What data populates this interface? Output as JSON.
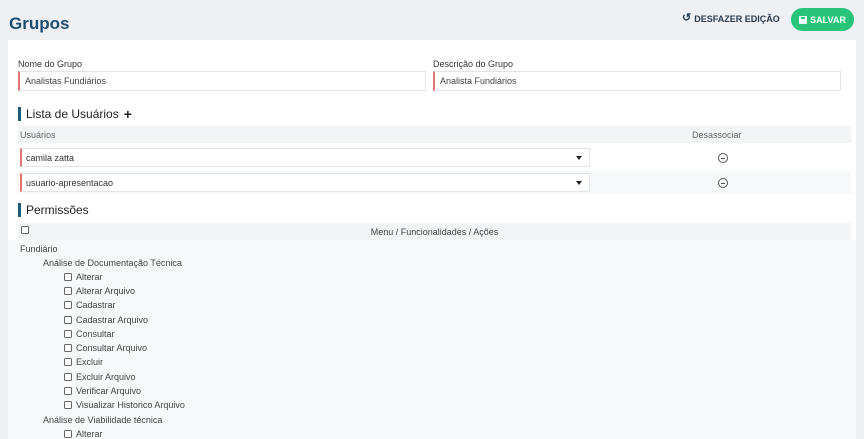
{
  "header": {
    "title": "Grupos",
    "undo_label": "DESFAZER EDIÇÃO",
    "save_label": "SALVAR"
  },
  "form": {
    "name_label": "Nome do Grupo",
    "name_value": "Analistas Fundiários",
    "desc_label": "Descrição do Grupo",
    "desc_value": "Analista Fundiários"
  },
  "users_section": {
    "title": "Lista de Usuários",
    "add_icon": "+",
    "col_users": "Usuários",
    "col_disassociate": "Desassociar",
    "rows": [
      {
        "user": "camila zatta"
      },
      {
        "user": "usuario-apresentacao"
      }
    ]
  },
  "permissions": {
    "title": "Permissões",
    "header": "Menu / Funcionalidades / Ações",
    "root": "Fundiário",
    "group1": {
      "label": "Análise de Documentação Técnica",
      "actions": [
        "Alterar",
        "Alterar Arquivo",
        "Cadastrar",
        "Cadastrar Arquivo",
        "Consultar",
        "Consultar Arquivo",
        "Excluir",
        "Excluir Arquivo",
        "Verificar Arquivo",
        "Visualizar Historico Arquivo"
      ]
    },
    "group2": {
      "label": "Análise de Viabilidade técnica",
      "actions": [
        "Alterar"
      ]
    }
  },
  "colors": {
    "accent": "#27c47a",
    "title": "#1e4d73",
    "required_border": "#e57373"
  }
}
